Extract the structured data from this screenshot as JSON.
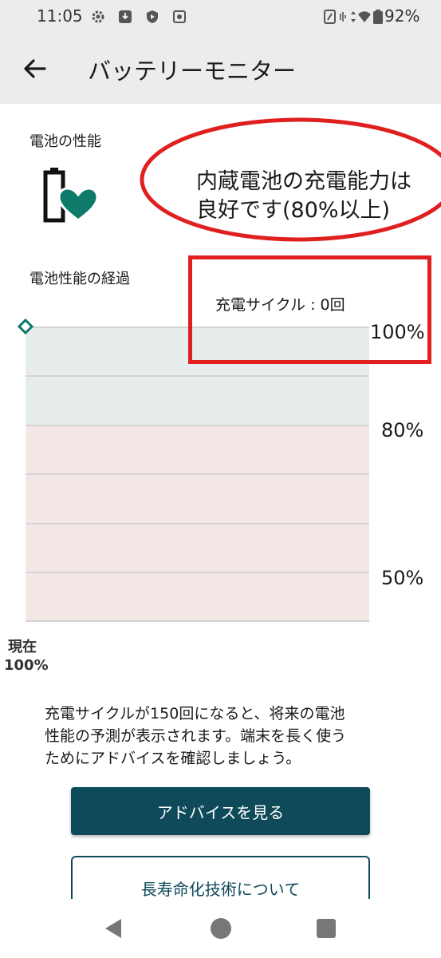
{
  "status_bar": {
    "time": "11:05",
    "battery_percent": "92%",
    "icons": [
      "gear-icon",
      "download-icon",
      "shield-icon",
      "settings-box-icon",
      "nfc-icon",
      "vibrate-icon",
      "data-arrows-icon",
      "wifi-icon",
      "battery-icon"
    ]
  },
  "app_bar": {
    "title": "バッテリーモニター",
    "back_icon": "arrow-left-icon"
  },
  "performance": {
    "label": "電池の性能",
    "status_line1": "内蔵電池の充電能力は",
    "status_line2": "良好です(80%以上)",
    "icon": "battery-heart-icon"
  },
  "history": {
    "label": "電池性能の経過",
    "cycles": "充電サイクル : 0回",
    "y_labels": {
      "top": "100%",
      "mid": "80%",
      "low": "50%"
    },
    "current_label": "現在",
    "current_value": "100%"
  },
  "description": {
    "line1": "充電サイクルが150回になると、将来の電池",
    "line2": "性能の予測が表示されます。端末を長く使う",
    "line3": "ためにアドバイスを確認しましょう。"
  },
  "buttons": {
    "advice": "アドバイスを見る",
    "longevity": "長寿命化技術について"
  },
  "colors": {
    "accent": "#0e4a59",
    "heart": "#0d7a6a",
    "annotation_red": "#e01f1f"
  }
}
